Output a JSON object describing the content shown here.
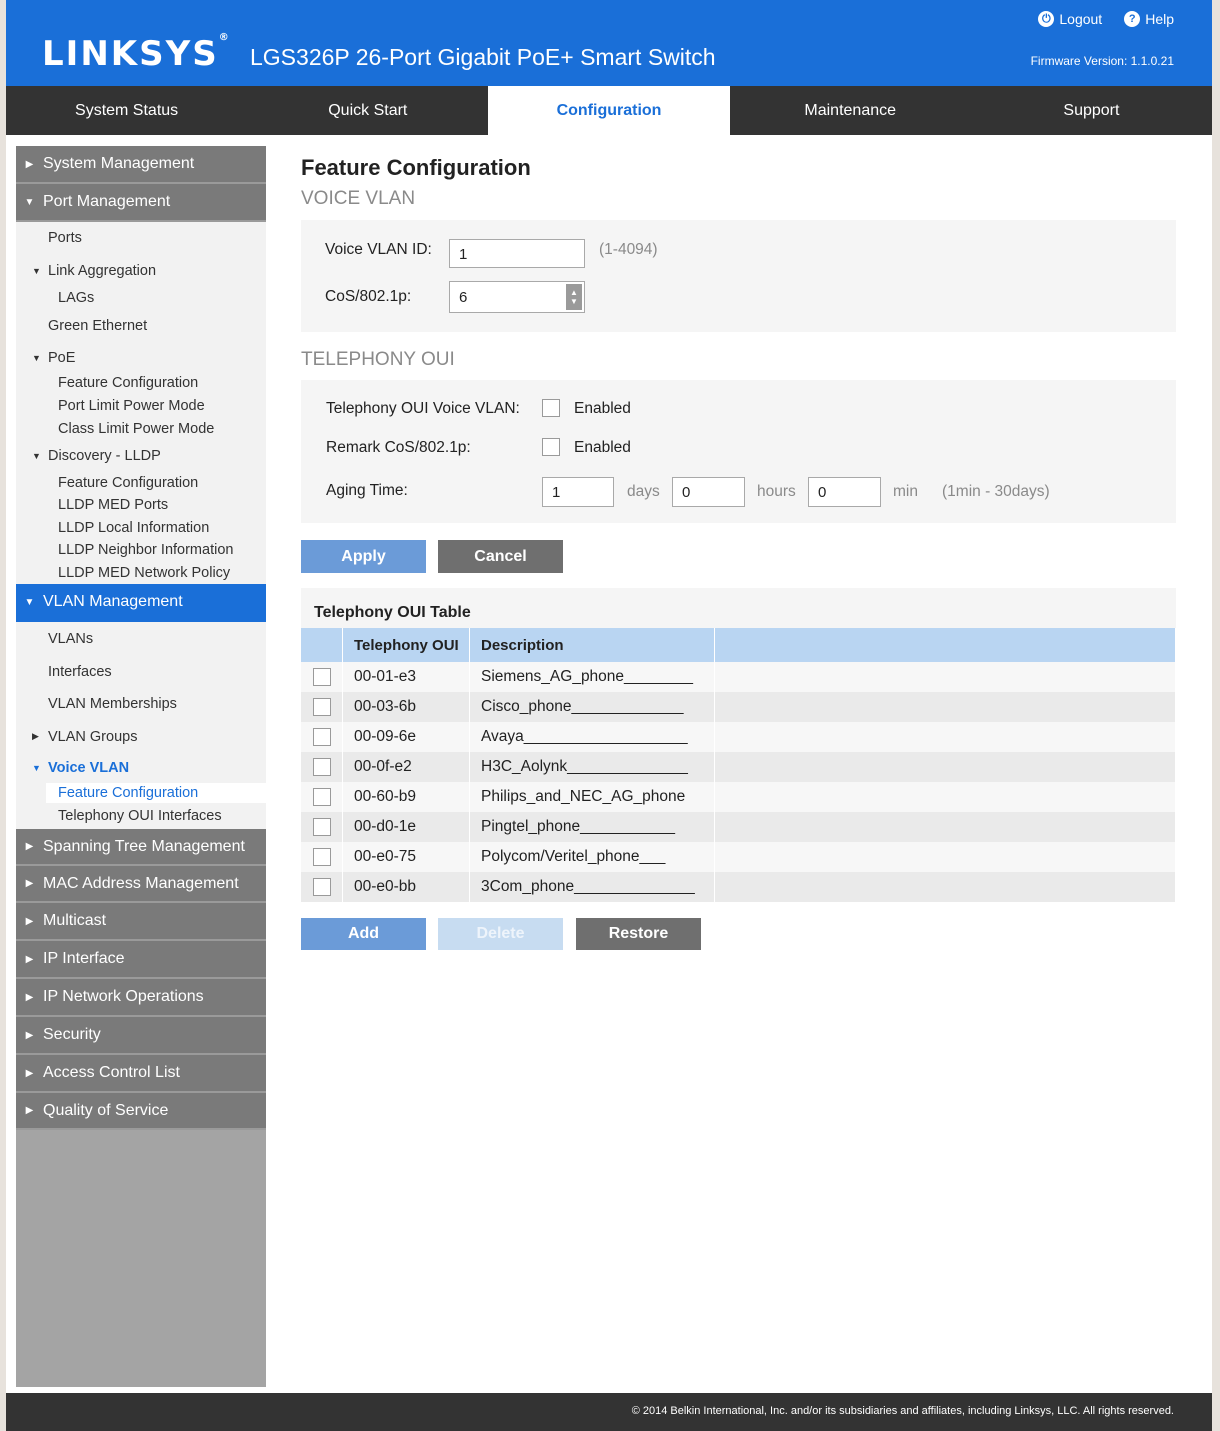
{
  "header": {
    "brand": "LINKSYS",
    "brand_mark": "®",
    "product": "LGS326P 26-Port Gigabit PoE+ Smart Switch",
    "logout": "Logout",
    "help": "Help",
    "firmware": "Firmware Version: 1.1.0.21"
  },
  "tabs": [
    "System Status",
    "Quick Start",
    "Configuration",
    "Maintenance",
    "Support"
  ],
  "sidebar": {
    "system_management": "System Management",
    "port_management": "Port Management",
    "ports": "Ports",
    "link_aggregation": "Link Aggregation",
    "lags": "LAGs",
    "green_ethernet": "Green Ethernet",
    "poe": "PoE",
    "poe_feature_configuration": "Feature Configuration",
    "port_limit_power_mode": "Port Limit Power Mode",
    "class_limit_power_mode": "Class Limit Power Mode",
    "discovery_lldp": "Discovery - LLDP",
    "lldp_feature_configuration": "Feature Configuration",
    "lldp_med_ports": "LLDP MED Ports",
    "lldp_local_information": "LLDP Local Information",
    "lldp_neighbor_information": "LLDP Neighbor Information",
    "lldp_med_network_policy": "LLDP MED Network Policy",
    "vlan_management": "VLAN Management",
    "vlans": "VLANs",
    "interfaces": "Interfaces",
    "vlan_memberships": "VLAN Memberships",
    "vlan_groups": "VLAN Groups",
    "voice_vlan": "Voice VLAN",
    "voice_feature_configuration": "Feature Configuration",
    "telephony_oui_interfaces": "Telephony OUI Interfaces",
    "spanning_tree": "Spanning Tree Management",
    "mac_address": "MAC Address Management",
    "multicast": "Multicast",
    "ip_interface": "IP Interface",
    "ip_network_operations": "IP Network Operations",
    "security": "Security",
    "acl": "Access Control List",
    "qos": "Quality of Service"
  },
  "main": {
    "title": "Feature Configuration",
    "voice_vlan": {
      "heading": "VOICE VLAN",
      "vlan_id_label": "Voice VLAN ID:",
      "vlan_id_value": "1",
      "vlan_id_range": "(1-4094)",
      "cos_label": "CoS/802.1p:",
      "cos_value": "6"
    },
    "telephony": {
      "heading": "TELEPHONY OUI",
      "oui_voice_vlan_label": "Telephony OUI Voice VLAN:",
      "remark_label": "Remark CoS/802.1p:",
      "enabled_text": "Enabled",
      "aging_label": "Aging Time:",
      "days_value": "1",
      "days_unit": "days",
      "hours_value": "0",
      "hours_unit": "hours",
      "min_value": "0",
      "min_unit": "min",
      "aging_range": "(1min - 30days)"
    },
    "apply": "Apply",
    "cancel": "Cancel",
    "table": {
      "title": "Telephony OUI Table",
      "col_oui": "Telephony OUI",
      "col_desc": "Description",
      "rows": [
        {
          "oui": "00-01-e3",
          "desc": "Siemens_AG_phone________"
        },
        {
          "oui": "00-03-6b",
          "desc": "Cisco_phone_____________"
        },
        {
          "oui": "00-09-6e",
          "desc": "Avaya___________________"
        },
        {
          "oui": "00-0f-e2",
          "desc": "H3C_Aolynk______________"
        },
        {
          "oui": "00-60-b9",
          "desc": "Philips_and_NEC_AG_phone"
        },
        {
          "oui": "00-d0-1e",
          "desc": "Pingtel_phone___________"
        },
        {
          "oui": "00-e0-75",
          "desc": "Polycom/Veritel_phone___"
        },
        {
          "oui": "00-e0-bb",
          "desc": "3Com_phone______________"
        }
      ]
    },
    "add": "Add",
    "delete": "Delete",
    "restore": "Restore"
  },
  "footer": "© 2014 Belkin International, Inc. and/or its subsidiaries and affiliates, including Linksys, LLC. All rights reserved."
}
